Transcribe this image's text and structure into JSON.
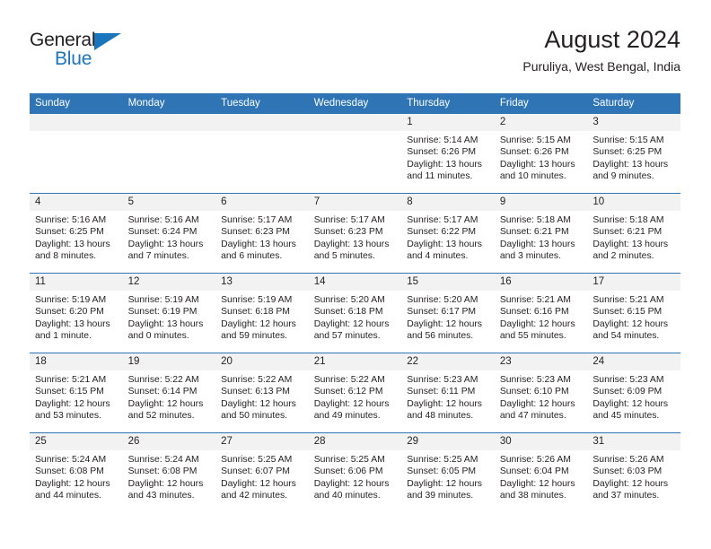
{
  "brand": {
    "name_top": "General",
    "name_bottom": "Blue",
    "triangle_icon": "blue-triangle-logo-mark",
    "accent_color": "#1b75bb"
  },
  "header": {
    "title": "August 2024",
    "subtitle": "Puruliya, West Bengal, India"
  },
  "calendar": {
    "header_color": "#2f75b5",
    "daynum_band_color": "#f2f2f2",
    "weekday_headers": [
      "Sunday",
      "Monday",
      "Tuesday",
      "Wednesday",
      "Thursday",
      "Friday",
      "Saturday"
    ],
    "weeks": [
      [
        {
          "day": "",
          "sunrise": "",
          "sunset": "",
          "daylight": ""
        },
        {
          "day": "",
          "sunrise": "",
          "sunset": "",
          "daylight": ""
        },
        {
          "day": "",
          "sunrise": "",
          "sunset": "",
          "daylight": ""
        },
        {
          "day": "",
          "sunrise": "",
          "sunset": "",
          "daylight": ""
        },
        {
          "day": "1",
          "sunrise": "Sunrise: 5:14 AM",
          "sunset": "Sunset: 6:26 PM",
          "daylight": "Daylight: 13 hours and 11 minutes."
        },
        {
          "day": "2",
          "sunrise": "Sunrise: 5:15 AM",
          "sunset": "Sunset: 6:26 PM",
          "daylight": "Daylight: 13 hours and 10 minutes."
        },
        {
          "day": "3",
          "sunrise": "Sunrise: 5:15 AM",
          "sunset": "Sunset: 6:25 PM",
          "daylight": "Daylight: 13 hours and 9 minutes."
        }
      ],
      [
        {
          "day": "4",
          "sunrise": "Sunrise: 5:16 AM",
          "sunset": "Sunset: 6:25 PM",
          "daylight": "Daylight: 13 hours and 8 minutes."
        },
        {
          "day": "5",
          "sunrise": "Sunrise: 5:16 AM",
          "sunset": "Sunset: 6:24 PM",
          "daylight": "Daylight: 13 hours and 7 minutes."
        },
        {
          "day": "6",
          "sunrise": "Sunrise: 5:17 AM",
          "sunset": "Sunset: 6:23 PM",
          "daylight": "Daylight: 13 hours and 6 minutes."
        },
        {
          "day": "7",
          "sunrise": "Sunrise: 5:17 AM",
          "sunset": "Sunset: 6:23 PM",
          "daylight": "Daylight: 13 hours and 5 minutes."
        },
        {
          "day": "8",
          "sunrise": "Sunrise: 5:17 AM",
          "sunset": "Sunset: 6:22 PM",
          "daylight": "Daylight: 13 hours and 4 minutes."
        },
        {
          "day": "9",
          "sunrise": "Sunrise: 5:18 AM",
          "sunset": "Sunset: 6:21 PM",
          "daylight": "Daylight: 13 hours and 3 minutes."
        },
        {
          "day": "10",
          "sunrise": "Sunrise: 5:18 AM",
          "sunset": "Sunset: 6:21 PM",
          "daylight": "Daylight: 13 hours and 2 minutes."
        }
      ],
      [
        {
          "day": "11",
          "sunrise": "Sunrise: 5:19 AM",
          "sunset": "Sunset: 6:20 PM",
          "daylight": "Daylight: 13 hours and 1 minute."
        },
        {
          "day": "12",
          "sunrise": "Sunrise: 5:19 AM",
          "sunset": "Sunset: 6:19 PM",
          "daylight": "Daylight: 13 hours and 0 minutes."
        },
        {
          "day": "13",
          "sunrise": "Sunrise: 5:19 AM",
          "sunset": "Sunset: 6:18 PM",
          "daylight": "Daylight: 12 hours and 59 minutes."
        },
        {
          "day": "14",
          "sunrise": "Sunrise: 5:20 AM",
          "sunset": "Sunset: 6:18 PM",
          "daylight": "Daylight: 12 hours and 57 minutes."
        },
        {
          "day": "15",
          "sunrise": "Sunrise: 5:20 AM",
          "sunset": "Sunset: 6:17 PM",
          "daylight": "Daylight: 12 hours and 56 minutes."
        },
        {
          "day": "16",
          "sunrise": "Sunrise: 5:21 AM",
          "sunset": "Sunset: 6:16 PM",
          "daylight": "Daylight: 12 hours and 55 minutes."
        },
        {
          "day": "17",
          "sunrise": "Sunrise: 5:21 AM",
          "sunset": "Sunset: 6:15 PM",
          "daylight": "Daylight: 12 hours and 54 minutes."
        }
      ],
      [
        {
          "day": "18",
          "sunrise": "Sunrise: 5:21 AM",
          "sunset": "Sunset: 6:15 PM",
          "daylight": "Daylight: 12 hours and 53 minutes."
        },
        {
          "day": "19",
          "sunrise": "Sunrise: 5:22 AM",
          "sunset": "Sunset: 6:14 PM",
          "daylight": "Daylight: 12 hours and 52 minutes."
        },
        {
          "day": "20",
          "sunrise": "Sunrise: 5:22 AM",
          "sunset": "Sunset: 6:13 PM",
          "daylight": "Daylight: 12 hours and 50 minutes."
        },
        {
          "day": "21",
          "sunrise": "Sunrise: 5:22 AM",
          "sunset": "Sunset: 6:12 PM",
          "daylight": "Daylight: 12 hours and 49 minutes."
        },
        {
          "day": "22",
          "sunrise": "Sunrise: 5:23 AM",
          "sunset": "Sunset: 6:11 PM",
          "daylight": "Daylight: 12 hours and 48 minutes."
        },
        {
          "day": "23",
          "sunrise": "Sunrise: 5:23 AM",
          "sunset": "Sunset: 6:10 PM",
          "daylight": "Daylight: 12 hours and 47 minutes."
        },
        {
          "day": "24",
          "sunrise": "Sunrise: 5:23 AM",
          "sunset": "Sunset: 6:09 PM",
          "daylight": "Daylight: 12 hours and 45 minutes."
        }
      ],
      [
        {
          "day": "25",
          "sunrise": "Sunrise: 5:24 AM",
          "sunset": "Sunset: 6:08 PM",
          "daylight": "Daylight: 12 hours and 44 minutes."
        },
        {
          "day": "26",
          "sunrise": "Sunrise: 5:24 AM",
          "sunset": "Sunset: 6:08 PM",
          "daylight": "Daylight: 12 hours and 43 minutes."
        },
        {
          "day": "27",
          "sunrise": "Sunrise: 5:25 AM",
          "sunset": "Sunset: 6:07 PM",
          "daylight": "Daylight: 12 hours and 42 minutes."
        },
        {
          "day": "28",
          "sunrise": "Sunrise: 5:25 AM",
          "sunset": "Sunset: 6:06 PM",
          "daylight": "Daylight: 12 hours and 40 minutes."
        },
        {
          "day": "29",
          "sunrise": "Sunrise: 5:25 AM",
          "sunset": "Sunset: 6:05 PM",
          "daylight": "Daylight: 12 hours and 39 minutes."
        },
        {
          "day": "30",
          "sunrise": "Sunrise: 5:26 AM",
          "sunset": "Sunset: 6:04 PM",
          "daylight": "Daylight: 12 hours and 38 minutes."
        },
        {
          "day": "31",
          "sunrise": "Sunrise: 5:26 AM",
          "sunset": "Sunset: 6:03 PM",
          "daylight": "Daylight: 12 hours and 37 minutes."
        }
      ]
    ]
  }
}
